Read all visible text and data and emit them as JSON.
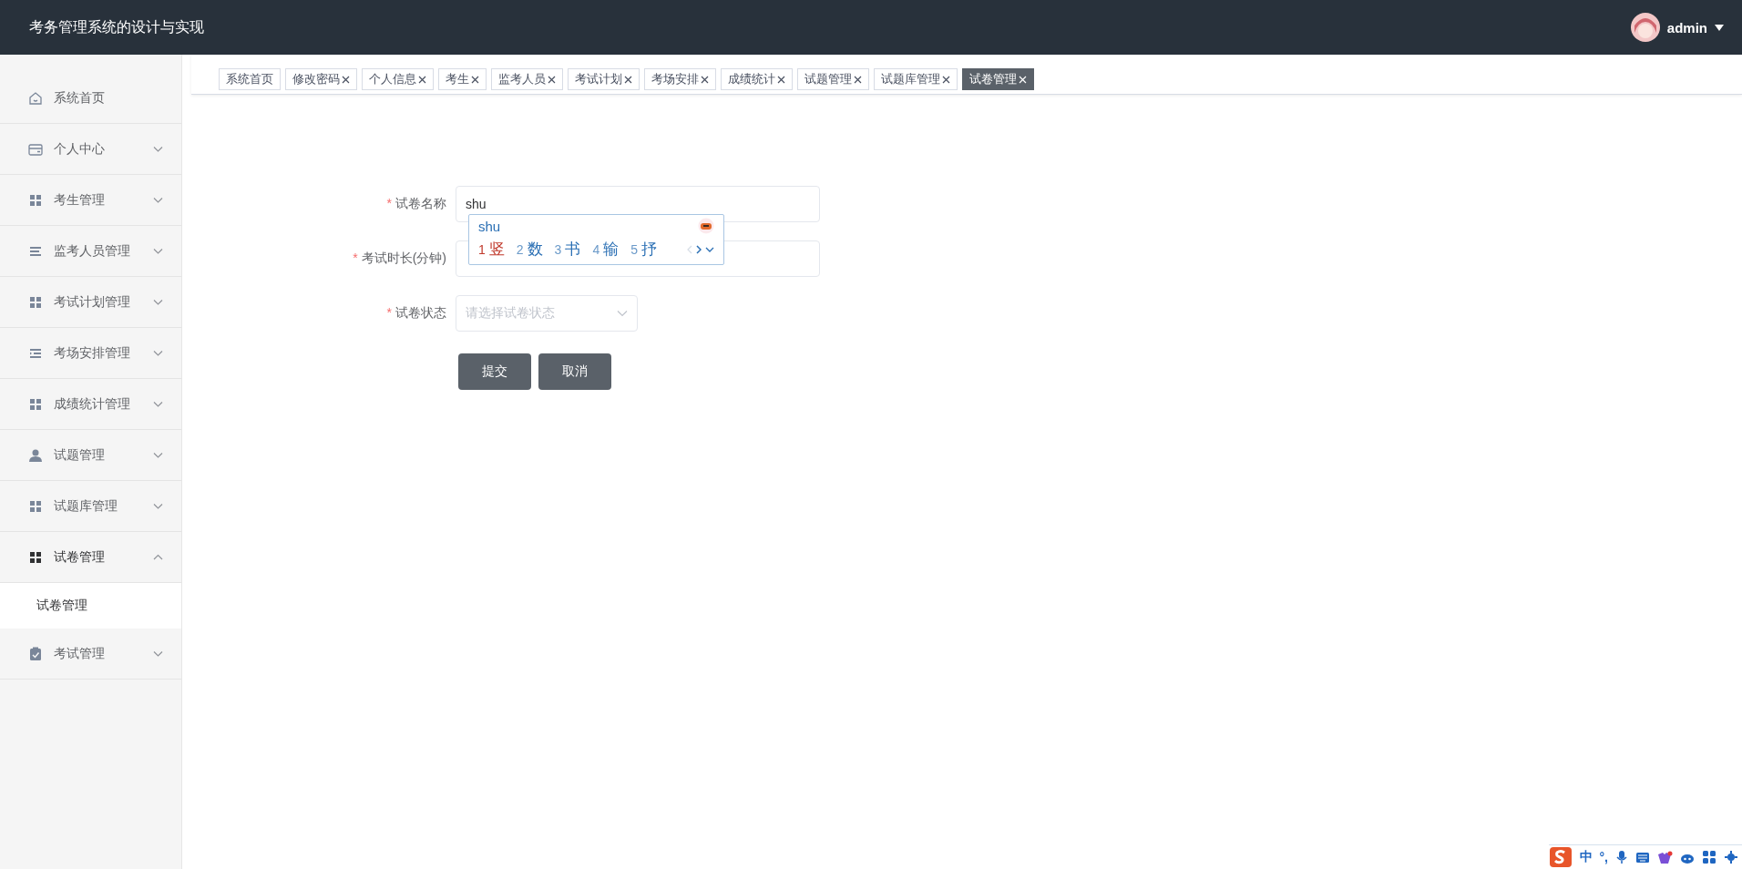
{
  "header": {
    "title": "考务管理系统的设计与实现",
    "user": "admin"
  },
  "sidebar": {
    "items": [
      {
        "label": "系统首页",
        "kind": "link",
        "expanded": false
      },
      {
        "label": "个人中心",
        "kind": "menu",
        "expanded": false
      },
      {
        "label": "考生管理",
        "kind": "menu",
        "expanded": false
      },
      {
        "label": "监考人员管理",
        "kind": "menu",
        "expanded": false
      },
      {
        "label": "考试计划管理",
        "kind": "menu",
        "expanded": false
      },
      {
        "label": "考场安排管理",
        "kind": "menu",
        "expanded": false
      },
      {
        "label": "成绩统计管理",
        "kind": "menu",
        "expanded": false
      },
      {
        "label": "试题管理",
        "kind": "menu",
        "expanded": false
      },
      {
        "label": "试题库管理",
        "kind": "menu",
        "expanded": false
      },
      {
        "label": "试卷管理",
        "kind": "menu",
        "expanded": true,
        "children": [
          {
            "label": "试卷管理",
            "selected": true
          }
        ]
      },
      {
        "label": "考试管理",
        "kind": "menu",
        "expanded": false
      }
    ]
  },
  "tabs": [
    {
      "label": "系统首页",
      "closable": false,
      "selected": false
    },
    {
      "label": "修改密码",
      "closable": true,
      "selected": false
    },
    {
      "label": "个人信息",
      "closable": true,
      "selected": false
    },
    {
      "label": "考生",
      "closable": true,
      "selected": false
    },
    {
      "label": "监考人员",
      "closable": true,
      "selected": false
    },
    {
      "label": "考试计划",
      "closable": true,
      "selected": false
    },
    {
      "label": "考场安排",
      "closable": true,
      "selected": false
    },
    {
      "label": "成绩统计",
      "closable": true,
      "selected": false
    },
    {
      "label": "试题管理",
      "closable": true,
      "selected": false
    },
    {
      "label": "试题库管理",
      "closable": true,
      "selected": false
    },
    {
      "label": "试卷管理",
      "closable": true,
      "selected": true
    }
  ],
  "form": {
    "fields": [
      {
        "label": "试卷名称",
        "mark": "*",
        "kind": "text",
        "value": "shu"
      },
      {
        "label": "考试时长(分钟)",
        "mark": "*",
        "kind": "text"
      },
      {
        "label": "试卷状态",
        "mark": "*",
        "kind": "select",
        "placeholder": "请选择试卷状态"
      }
    ],
    "buttons": [
      "提交",
      "取消"
    ]
  },
  "ime": {
    "composition": "shu",
    "candidates": [
      {
        "number": "1",
        "text": "竖",
        "selected": true
      },
      {
        "number": "2",
        "text": "数",
        "selected": false
      },
      {
        "number": "3",
        "text": "书",
        "selected": false
      },
      {
        "number": "4",
        "text": "输",
        "selected": false
      },
      {
        "number": "5",
        "text": "抒",
        "selected": false
      }
    ]
  },
  "ime_toolbar": {
    "mode": "中",
    "punctuation": "°,"
  }
}
